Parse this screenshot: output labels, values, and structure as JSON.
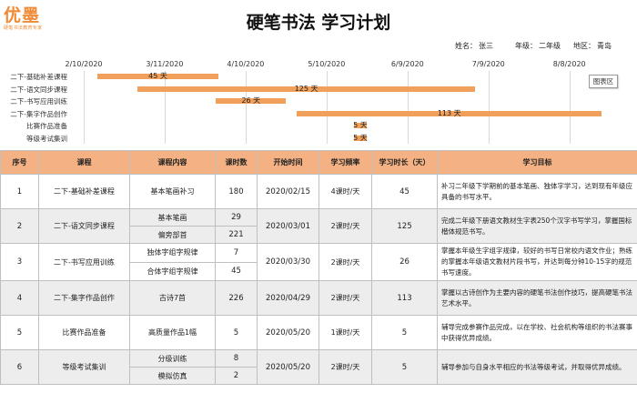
{
  "logo": {
    "main": "优墨",
    "sub": "硬笔书法教育专家"
  },
  "title": "硬笔书法 学习计划",
  "info": {
    "name_label": "姓名：",
    "name": "张三",
    "grade_label": "年级：",
    "grade": "二年级",
    "region_label": "地区：",
    "region": "青岛"
  },
  "gantt": {
    "dates": [
      "2/10/2020",
      "3/11/2020",
      "4/10/2020",
      "5/10/2020",
      "6/9/2020",
      "7/9/2020",
      "8/8/2020"
    ],
    "legend_button": "图表区",
    "tasks": [
      {
        "name": "二下-基础补差课程",
        "start": "2020-02-15",
        "days": 45,
        "label": "45 天"
      },
      {
        "name": "二下-语文同步课程",
        "start": "2020-03-01",
        "days": 125,
        "label": "125 天"
      },
      {
        "name": "二下-书写应用训练",
        "start": "2020-03-30",
        "days": 26,
        "label": "26 天"
      },
      {
        "name": "二下-集字作品创作",
        "start": "2020-04-29",
        "days": 113,
        "label": "113 天"
      },
      {
        "name": "比赛作品准备",
        "start": "2020-05-20",
        "days": 5,
        "label": "5 天"
      },
      {
        "name": "等级考试集训",
        "start": "2020-05-20",
        "days": 5,
        "label": "5 天"
      }
    ]
  },
  "table": {
    "headers": [
      "序号",
      "课程",
      "课程内容",
      "课时数",
      "开始时间",
      "学习频率",
      "学习时长（天）",
      "学习目标"
    ],
    "rows": [
      {
        "no": "1",
        "course": "二下-基础补差课程",
        "sub": [
          {
            "content": "基本笔画补习",
            "hours": "180"
          }
        ],
        "start": "2020/02/15",
        "freq": "4课时/天",
        "days": "45",
        "goal": "补习二年级下学期前的基本笔画、独体字学习，达到现有年级应具备的书写水平。"
      },
      {
        "no": "2",
        "course": "二下-语文同步课程",
        "sub": [
          {
            "content": "基本笔画",
            "hours": "29"
          },
          {
            "content": "偏旁部首",
            "hours": "221"
          }
        ],
        "start": "2020/03/01",
        "freq": "2课时/天",
        "days": "125",
        "goal": "完成二年级下册语文教材生字表250个汉字书写学习，掌握国标楷体规范书写。"
      },
      {
        "no": "3",
        "course": "二下-书写应用训练",
        "sub": [
          {
            "content": "独体字组字规律",
            "hours": "7"
          },
          {
            "content": "合体字组字规律",
            "hours": "45"
          }
        ],
        "start": "2020/03/30",
        "freq": "2课时/天",
        "days": "26",
        "goal": "掌握本年级生字组字规律，较好的书写日常校内语文作业；熟练的掌握本年级语文教材片段书写，并达到每分钟10-15字的规范书写速度。"
      },
      {
        "no": "4",
        "course": "二下-集字作品创作",
        "sub": [
          {
            "content": "古诗7首",
            "hours": "226"
          }
        ],
        "start": "2020/04/29",
        "freq": "2课时/天",
        "days": "113",
        "goal": "掌握以古诗创作为主要内容的硬笔书法创作技巧，提高硬笔书法艺术水平。"
      },
      {
        "no": "5",
        "course": "比赛作品准备",
        "sub": [
          {
            "content": "高质量作品1幅",
            "hours": "5"
          }
        ],
        "start": "2020/05/20",
        "freq": "1课时/天",
        "days": "5",
        "goal": "辅导完成参赛作品完成，以在学校、社会机构等组织的书法赛事中获得优异成绩。"
      },
      {
        "no": "6",
        "course": "等级考试集训",
        "sub": [
          {
            "content": "分级训练",
            "hours": "8"
          },
          {
            "content": "模拟仿真",
            "hours": "2"
          }
        ],
        "start": "2020/05/20",
        "freq": "2课时/天",
        "days": "5",
        "goal": "辅导参加与自身水平相应的书法等级考试，并取得优异成绩。"
      }
    ]
  },
  "colors": {
    "accent": "#f08a34",
    "header_bg": "#f4b183",
    "bar": "#f0a05a",
    "row_alt": "#ededed"
  }
}
